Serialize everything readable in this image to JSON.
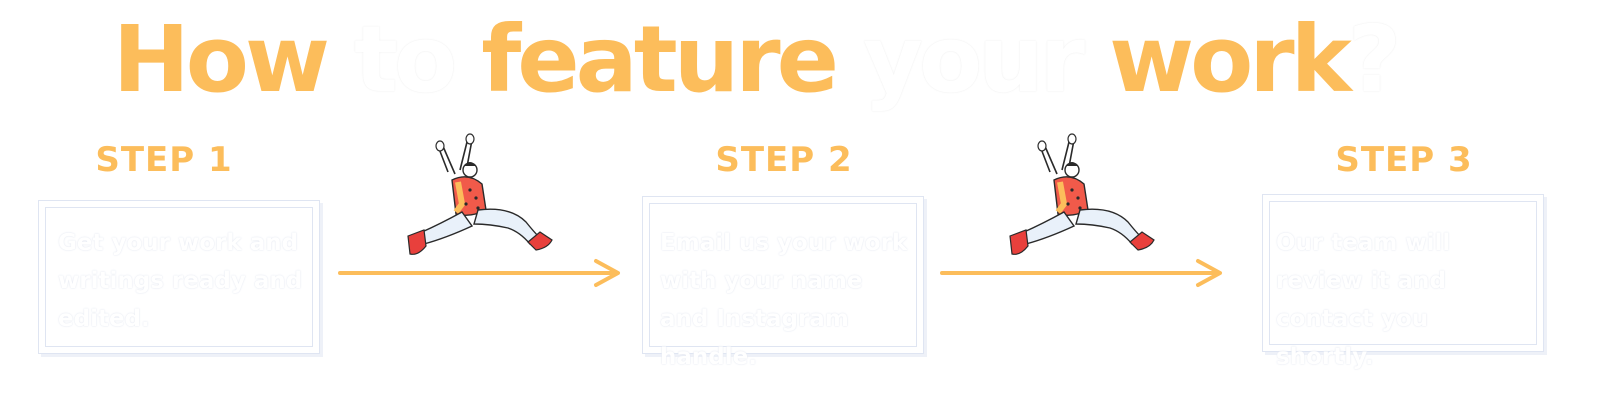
{
  "title": {
    "part1": "How",
    "part2": "to",
    "part3": "feature",
    "part4": "your",
    "part5": "work",
    "part6": "?"
  },
  "steps": [
    {
      "heading": "STEP 1",
      "text": "Get your work and writings ready and edited."
    },
    {
      "heading": "STEP 2",
      "text": "Email us your work with your name and Instagram handle."
    },
    {
      "heading": "STEP 3",
      "text": "Our team will review it and contact you shortly."
    }
  ],
  "colors": {
    "accent": "#fcbd5b",
    "runner_shirt": "#f15a4a",
    "runner_shoes": "#e8403c",
    "runner_pants": "#e9f1fa"
  },
  "icons": {
    "runner": "running-person-illustration",
    "arrow": "right-arrow-icon"
  }
}
